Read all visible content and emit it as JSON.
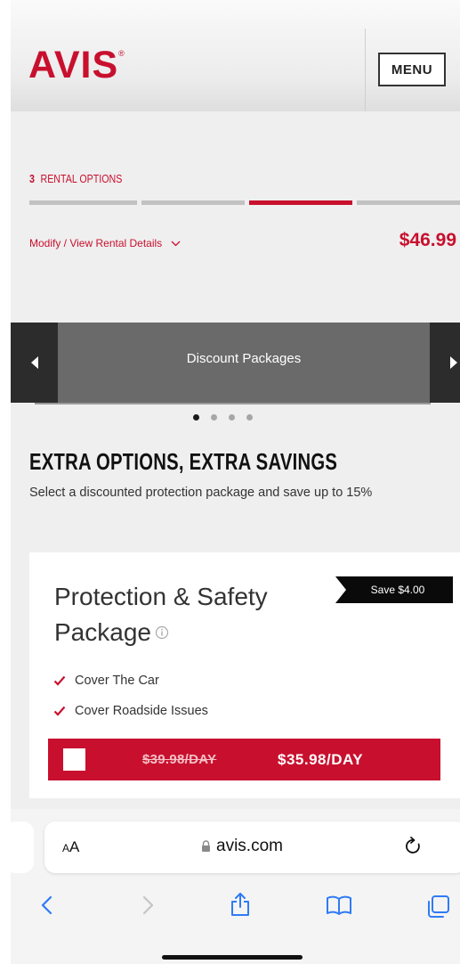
{
  "header": {
    "logo": "AVIS",
    "logo_mark": "®",
    "menu_label": "MENU"
  },
  "progress": {
    "step_number": "3",
    "step_label": "RENTAL OPTIONS",
    "total_segments": 4,
    "active_segment": 3
  },
  "rental": {
    "modify_link": "Modify / View Rental Details",
    "total_price": "$46.99"
  },
  "carousel": {
    "title": "Discount Packages",
    "dot_count": 4,
    "active_dot": 1
  },
  "extra_options": {
    "title": "EXTRA OPTIONS, EXTRA SAVINGS",
    "description": "Select a discounted protection package and save up to 15%"
  },
  "package": {
    "title": "Protection & Safety Package",
    "save_badge": "Save $4.00",
    "features": [
      "Cover The Car",
      "Cover Roadside Issues"
    ],
    "old_price": "$39.98/DAY",
    "new_price": "$35.98/DAY",
    "selected": false
  },
  "browser": {
    "text_size_label_small": "A",
    "text_size_label_large": "A",
    "url": "avis.com"
  },
  "colors": {
    "brand_red": "#c8102e",
    "carousel_bg": "#6a6a6a",
    "carousel_arrow_bg": "#2c2c2c",
    "ios_blue": "#2f7bf6"
  }
}
